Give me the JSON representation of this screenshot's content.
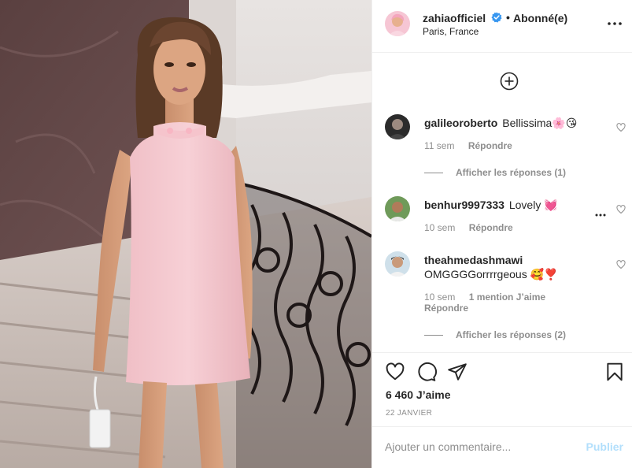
{
  "post": {
    "image": {
      "alt": "",
      "icon": "photo"
    },
    "header": {
      "username": "zahiaofficiel",
      "verified_icon": "verified-badge-icon",
      "separator": "•",
      "follow_label": "Abonné(e)",
      "location": "Paris, France",
      "more_icon": "more-options-icon"
    },
    "load_more_icon": "plus-circle-icon",
    "comments": [
      {
        "username": "galileoroberto",
        "text": "Bellissima🌸😘",
        "time": "11 sem",
        "reply_label": "Répondre",
        "likes_label": "",
        "view_replies": "Afficher les réponses (1)"
      },
      {
        "username": "benhur9997333",
        "text": "Lovely 💓",
        "time": "10 sem",
        "reply_label": "Répondre",
        "likes_label": "",
        "view_replies": ""
      },
      {
        "username": "theahmedashmawi",
        "text": "OMGGGGorrrrgeous 🥰❣️",
        "time": "10 sem",
        "reply_label": "Répondre",
        "likes_label": "1 mention J’aime",
        "view_replies": "Afficher les réponses (2)"
      }
    ],
    "actions": {
      "like_icon": "heart-icon",
      "comment_icon": "comment-icon",
      "share_icon": "share-icon",
      "save_icon": "bookmark-icon"
    },
    "likes": "6 460 J’aime",
    "date": "22 JANVIER",
    "add_comment": {
      "placeholder": "Ajouter un commentaire...",
      "publish_label": "Publier"
    },
    "colors": {
      "text": "#262626",
      "secondary": "#8e8e8e",
      "border": "#efefef",
      "verified": "#3897f0",
      "publish_disabled": "#b2dffc"
    }
  }
}
